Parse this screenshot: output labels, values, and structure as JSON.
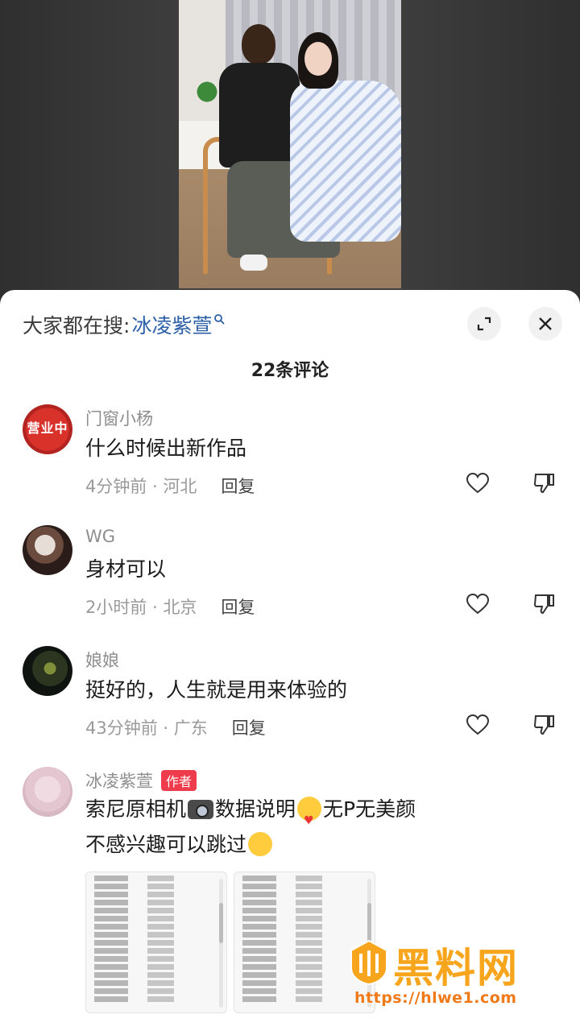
{
  "search_bar": {
    "prefix": "大家都在搜:",
    "keyword": "冰凌紫萱"
  },
  "header": {
    "comment_count": "22条评论"
  },
  "comments": [
    {
      "username": "门窗小杨",
      "avatar_text": "营业中",
      "text": "什么时候出新作品",
      "time_location": "4分钟前 · 河北",
      "reply_label": "回复"
    },
    {
      "username": "WG",
      "text": "身材可以",
      "time_location": "2小时前 · 北京",
      "reply_label": "回复"
    },
    {
      "username": "娘娘",
      "text": "挺好的，人生就是用来体验的",
      "time_location": "43分钟前 · 广东",
      "reply_label": "回复"
    },
    {
      "username": "冰凌紫萱",
      "badge": "作者",
      "text_part1": "索尼原相机",
      "text_part2": "数据说明",
      "text_part3": "无P无美颜",
      "text_line2": "不感兴趣可以跳过"
    }
  ],
  "watermark": {
    "title": "黑料网",
    "url": "https://hlwe1.com"
  },
  "colors": {
    "keyword": "#2b5fa8",
    "author_badge": "#ef3c4c",
    "watermark": "#f7a51c"
  }
}
